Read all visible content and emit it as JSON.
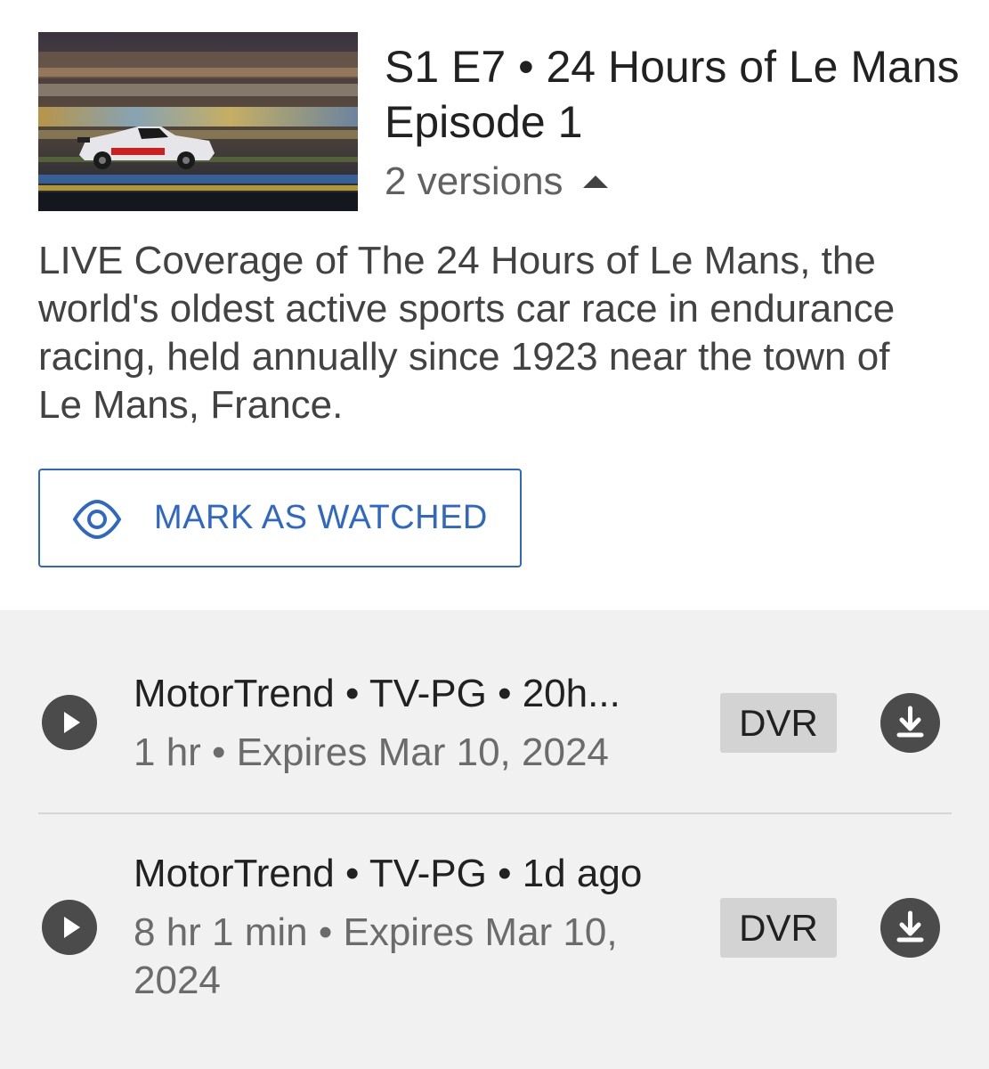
{
  "episode": {
    "title": "S1 E7 • 24 Hours of Le Mans Episode 1",
    "versions_label": "2 versions",
    "description": "LIVE Coverage of The 24 Hours of Le Mans, the world's oldest active sports car race in endurance racing, held annually since 1923 near the town of Le Mans, France.",
    "mark_watched_label": "MARK AS WATCHED"
  },
  "versions": [
    {
      "line1": "MotorTrend • TV-PG • 20h...",
      "line2": "1 hr • Expires Mar 10, 2024",
      "badge": "DVR"
    },
    {
      "line1": "MotorTrend • TV-PG • 1d ago",
      "line2": "8 hr 1 min • Expires Mar 10, 2024",
      "badge": "DVR"
    }
  ],
  "icons": {
    "versions_toggle": "caret-up-icon",
    "mark_watched": "eye-icon",
    "play": "play-icon",
    "download": "download-icon"
  },
  "colors": {
    "accent": "#2f67c7",
    "panel_background": "#f1f1f1",
    "badge_background": "#d3d3d3"
  }
}
